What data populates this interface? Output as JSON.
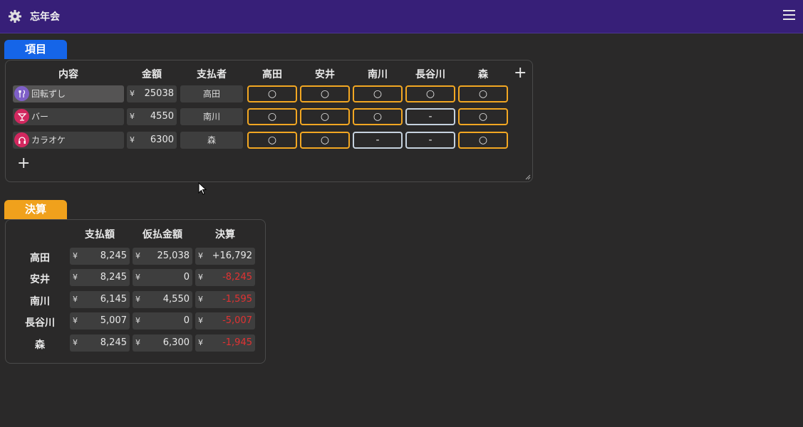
{
  "app": {
    "title": "忘年会"
  },
  "items_tab": {
    "label": "項目"
  },
  "settle_tab": {
    "label": "決算"
  },
  "items_headers": {
    "content": "内容",
    "amount": "金額",
    "payer": "支払者"
  },
  "members": [
    "高田",
    "安井",
    "南川",
    "長谷川",
    "森"
  ],
  "currency": "¥",
  "add_symbol": "+",
  "items": [
    {
      "icon": "fork-knife-icon",
      "icon_color": "#7e5fc7",
      "name": "回転ずし",
      "amount": "25038",
      "payer": "高田",
      "marks": [
        "○",
        "○",
        "○",
        "○",
        "○"
      ]
    },
    {
      "icon": "cocktail-icon",
      "icon_color": "#d2285f",
      "name": "バー",
      "amount": "4550",
      "payer": "南川",
      "marks": [
        "○",
        "○",
        "○",
        "-",
        "○"
      ]
    },
    {
      "icon": "headphones-icon",
      "icon_color": "#d2285f",
      "name": "カラオケ",
      "amount": "6300",
      "payer": "森",
      "marks": [
        "○",
        "○",
        "-",
        "-",
        "○"
      ]
    }
  ],
  "settle_headers": {
    "paid": "支払額",
    "advance": "仮払金額",
    "settlement": "決算"
  },
  "settlement": [
    {
      "name": "高田",
      "paid": "8,245",
      "advance": "25,038",
      "result": "+16,792",
      "negative": false
    },
    {
      "name": "安井",
      "paid": "8,245",
      "advance": "0",
      "result": "-8,245",
      "negative": true
    },
    {
      "name": "南川",
      "paid": "6,145",
      "advance": "4,550",
      "result": "-1,595",
      "negative": true
    },
    {
      "name": "長谷川",
      "paid": "5,007",
      "advance": "0",
      "result": "-5,007",
      "negative": true
    },
    {
      "name": "森",
      "paid": "8,245",
      "advance": "6,300",
      "result": "-1,945",
      "negative": true
    }
  ],
  "colors": {
    "header_bar": "#371f78",
    "items_tab": "#1565e8",
    "settle_tab": "#f0a11c",
    "mark_on": "#f2a722",
    "mark_off": "#c6d2de",
    "negative": "#e23232"
  }
}
